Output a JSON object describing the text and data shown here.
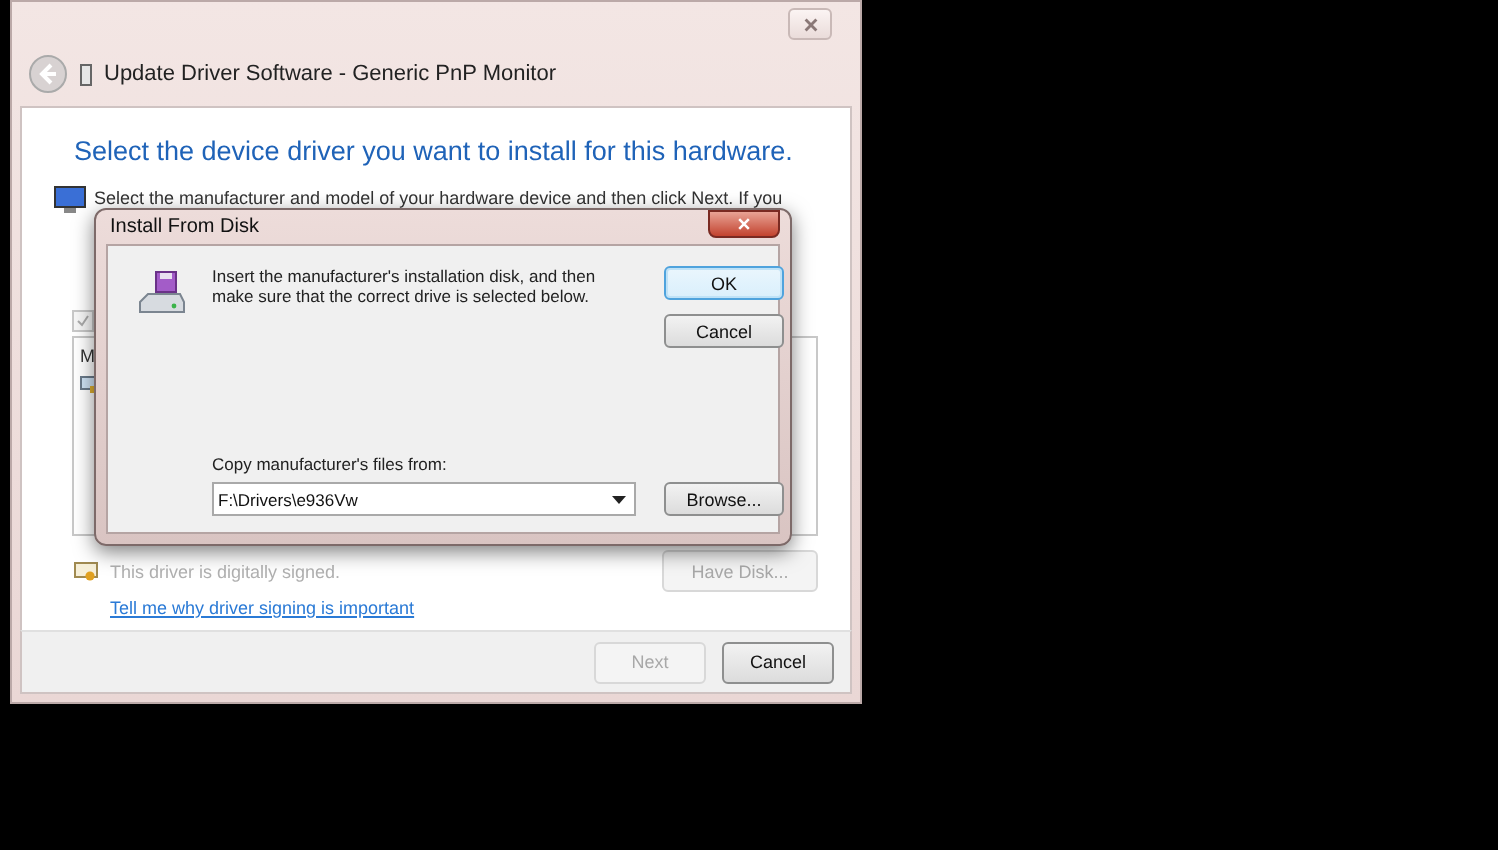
{
  "window": {
    "title": "Update Driver Software - Generic PnP Monitor"
  },
  "wizard": {
    "heading": "Select the device driver you want to install for this hardware.",
    "instruction": "Select the manufacturer and model of your hardware device and then click Next. If you",
    "show_compatible": {
      "checked": true,
      "disabled": true
    },
    "list": {
      "header": "M"
    },
    "signature": {
      "text": "This driver is digitally signed.",
      "disabled": true
    },
    "have_disk": {
      "label": "Have Disk...",
      "disabled": true
    },
    "link": "Tell me why driver signing is important"
  },
  "footer": {
    "buttons": [
      {
        "label": "Next",
        "disabled": true
      },
      {
        "label": "Cancel",
        "disabled": false
      }
    ]
  },
  "dialog": {
    "title": "Install From Disk",
    "message": "Insert the manufacturer's installation disk, and then make sure that the correct drive is selected below.",
    "buttons": [
      {
        "label": "OK",
        "default": true
      },
      {
        "label": "Cancel",
        "default": false
      }
    ],
    "source_label": "Copy manufacturer's files from:",
    "source_value": "F:\\Drivers\\e936Vw",
    "browse": "Browse..."
  }
}
